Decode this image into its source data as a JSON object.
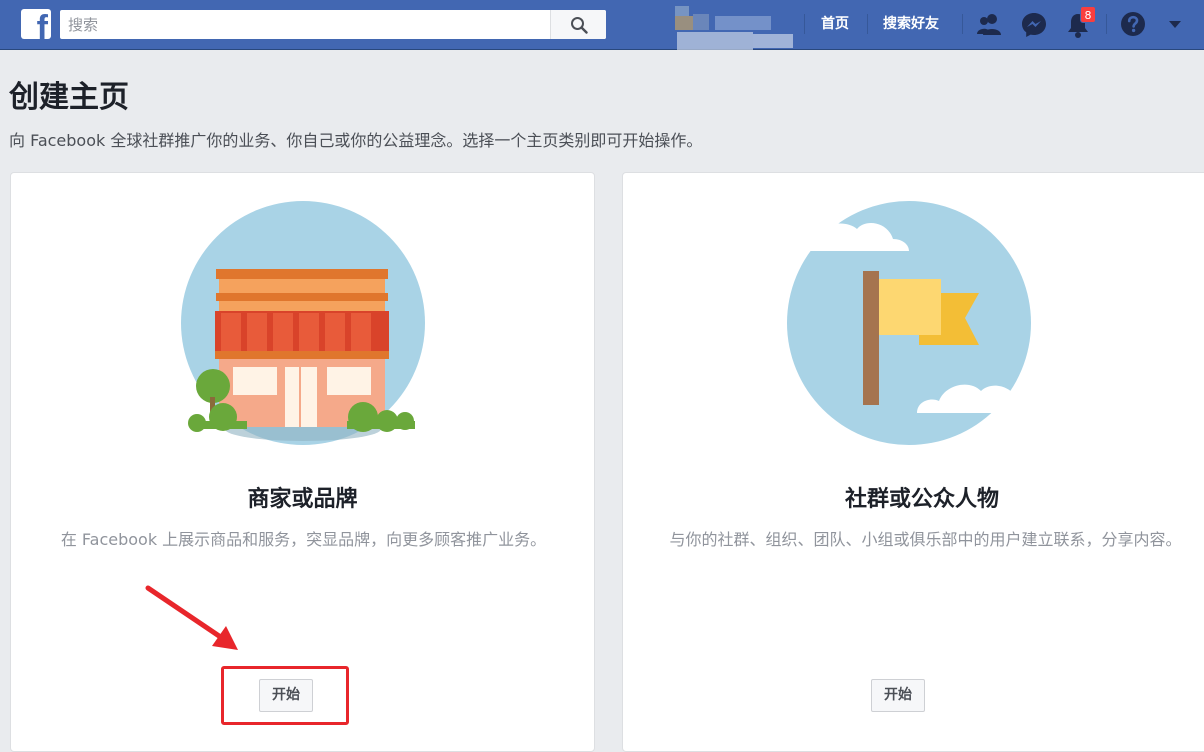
{
  "topbar": {
    "logo_letter": "f",
    "search": {
      "placeholder": "搜索",
      "value": ""
    },
    "nav": {
      "home_label": "首页",
      "find_friends_label": "搜索好友",
      "notification_count": "8"
    },
    "icons": [
      "facebook-logo-icon",
      "search-icon",
      "friend-requests-icon",
      "messenger-icon",
      "notifications-bell-icon",
      "help-icon",
      "account-menu-caret-icon"
    ]
  },
  "page": {
    "title": "创建主页",
    "subtitle": "向 Facebook 全球社群推广你的业务、你自己或你的公益理念。选择一个主页类别即可开始操作。"
  },
  "cards": [
    {
      "title": "商家或品牌",
      "description": "在 Facebook 上展示商品和服务，突显品牌，向更多顾客推广业务。",
      "button_label": "开始",
      "illustration": "storefront-icon"
    },
    {
      "title": "社群或公众人物",
      "description": "与你的社群、组织、团队、小组或俱乐部中的用户建立联系，分享内容。",
      "button_label": "开始",
      "illustration": "flag-icon"
    }
  ],
  "colors": {
    "topbar": "#4267b2",
    "background": "#e9ebee",
    "annotation": "#e8262b",
    "illustration_sky": "#a9d3e6"
  }
}
